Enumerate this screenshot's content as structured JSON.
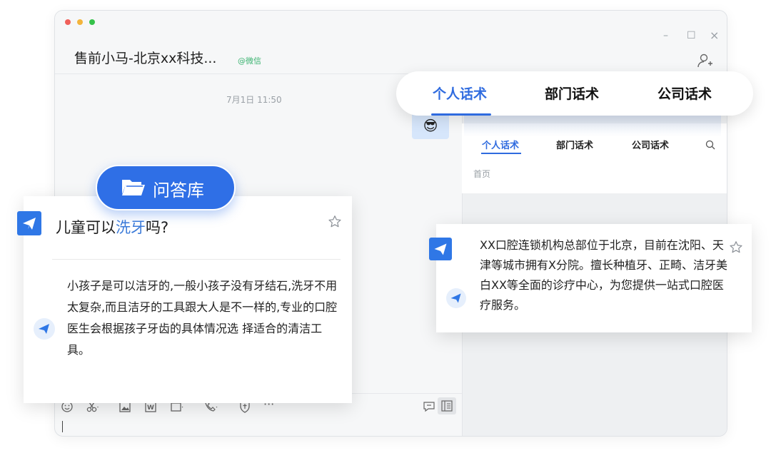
{
  "window": {
    "title": "售前小马-北京xx科技...",
    "tag": "@微信",
    "controls": {
      "minimize": "–",
      "maximize": "☐",
      "close": "×"
    }
  },
  "chat": {
    "timestamp": "7月1日 11:50",
    "emoji": "😎"
  },
  "side_panel": {
    "tabs": [
      "个人话术",
      "部门话术",
      "公司话术"
    ],
    "active_tab": 0,
    "breadcrumb": "首页"
  },
  "floating_tabs": {
    "tabs": [
      "个人话术",
      "部门话术",
      "公司话术"
    ],
    "active_tab": 0
  },
  "library_button": {
    "label": "问答库"
  },
  "qa_card": {
    "question_prefix": "儿童可以",
    "question_highlight": "洗牙",
    "question_suffix": "吗?",
    "answer": "小孩子是可以洁牙的,一般小孩子没有牙结石,洗牙不用太复杂,而且洁牙的工具跟大人是不一样的,专业的口腔医生会根据孩子牙齿的具体情况选 择适合的清洁工具。"
  },
  "answer_card": {
    "text": "XX口腔连锁机构总部位于北京，目前在沈阳、天津等城市拥有X分院。擅长种植牙、正畸、洁牙美白XX等全面的诊疗中心，为您提供一站式口腔医疗服务。"
  },
  "toolbar": {
    "icons": [
      "emoji-icon",
      "scissors-icon",
      "image-icon",
      "word-file-icon",
      "folder-icon",
      "phone-icon",
      "shield-icon",
      "more-icon"
    ],
    "more_label": "···"
  },
  "colors": {
    "accent": "#2f6fe6",
    "brand_tag": "#3cb371",
    "traffic_red": "#f0605a",
    "traffic_yellow": "#f3b43c",
    "traffic_green": "#35c24a"
  }
}
